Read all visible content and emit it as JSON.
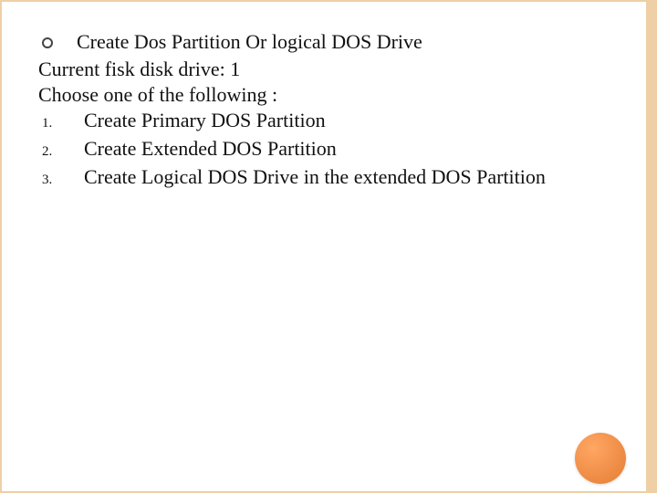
{
  "heading": "Create Dos Partition Or logical DOS Drive",
  "line_current": "Current fisk disk drive: 1",
  "line_choose": "Choose one of the following :",
  "options": [
    {
      "num": "1.",
      "text": "Create Primary DOS Partition"
    },
    {
      "num": "2.",
      "text": "Create Extended DOS Partition"
    },
    {
      "num": "3.",
      "text": "Create Logical DOS Drive in the extended DOS Partition"
    }
  ]
}
